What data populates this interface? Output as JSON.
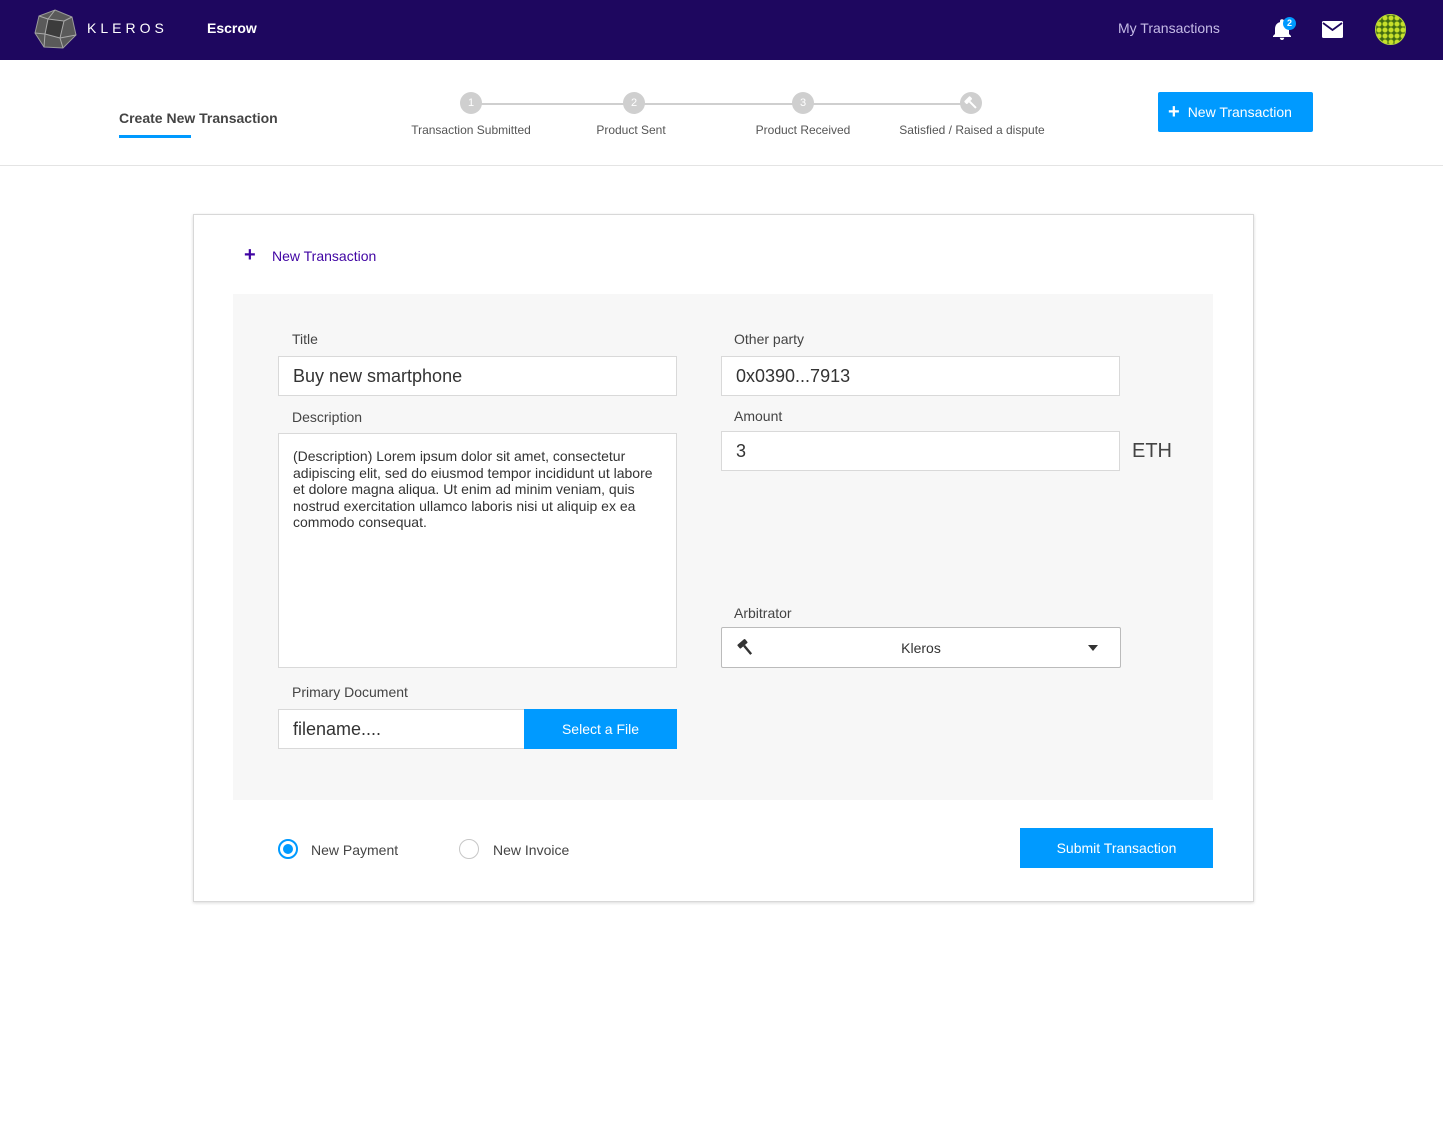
{
  "nav": {
    "brand": "KLEROS",
    "escrow": "Escrow",
    "my_transactions": "My Transactions",
    "notification_count": "2",
    "logo_icon": "kleros-logo-icon",
    "bell_icon": "bell-icon",
    "mail_icon": "mail-icon",
    "colors": {
      "background": "#1e075f",
      "accent": "#009aff"
    }
  },
  "subheader": {
    "title": "Create New Transaction",
    "steps": [
      {
        "marker": "1",
        "label": "Transaction Submitted"
      },
      {
        "marker": "2",
        "label": "Product Sent"
      },
      {
        "marker": "3",
        "label": "Product Received"
      },
      {
        "marker": "gavel-icon",
        "label": "Satisfied / Raised a dispute"
      }
    ],
    "new_transaction_button": "New Transaction"
  },
  "form": {
    "header": "New Transaction",
    "title_label": "Title",
    "title_value": "Buy new smartphone",
    "description_label": "Description",
    "description_value": "(Description) Lorem ipsum dolor sit amet, consectetur adipiscing elit, sed do eiusmod tempor incididunt ut labore et dolore magna aliqua. Ut enim ad minim veniam, quis nostrud exercitation ullamco laboris nisi ut aliquip ex ea commodo consequat.",
    "other_party_label": "Other party",
    "other_party_value": "0x0390...7913",
    "amount_label": "Amount",
    "amount_value": "3",
    "amount_unit": "ETH",
    "arbitrator_label": "Arbitrator",
    "arbitrator_value": "Kleros",
    "primary_document_label": "Primary Document",
    "primary_document_value": "filename....",
    "select_file_button": "Select a File",
    "payment_type": {
      "options": [
        "New Payment",
        "New Invoice"
      ],
      "selected": "New Payment"
    },
    "submit_button": "Submit Transaction"
  }
}
